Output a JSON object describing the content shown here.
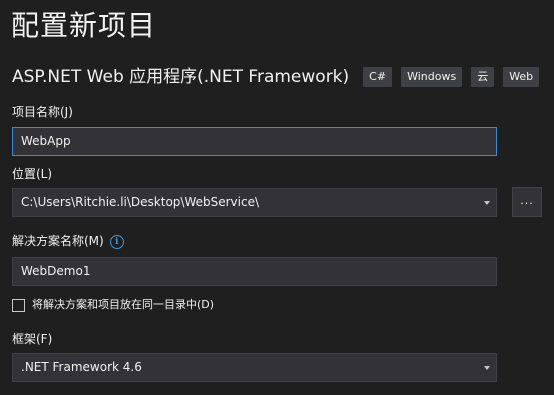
{
  "page": {
    "title": "配置新项目"
  },
  "project_type": {
    "name": "ASP.NET Web 应用程序(.NET Framework)",
    "tags": [
      "C#",
      "Windows",
      "云",
      "Web"
    ]
  },
  "project_name": {
    "label": "项目名称(J)",
    "value": "WebApp"
  },
  "location": {
    "label": "位置(L)",
    "value": "C:\\Users\\Ritchie.li\\Desktop\\WebService\\",
    "browse_label": "..."
  },
  "solution_name": {
    "label": "解决方案名称(M)",
    "value": "WebDemo1",
    "info_glyph": "i"
  },
  "same_directory": {
    "label": "将解决方案和项目放在同一目录中(D)",
    "checked": false
  },
  "framework": {
    "label": "框架(F)",
    "value": ".NET Framework 4.6"
  }
}
